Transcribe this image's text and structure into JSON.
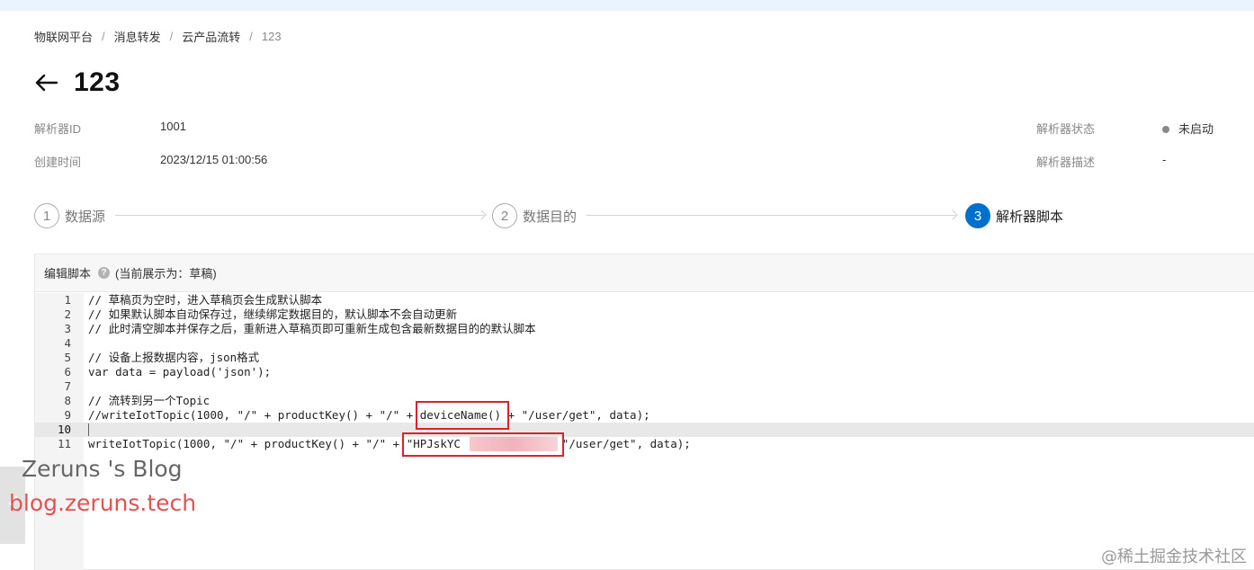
{
  "breadcrumb": {
    "items": [
      "物联网平台",
      "消息转发",
      "云产品流转"
    ],
    "current": "123",
    "separator": "/"
  },
  "page": {
    "title": "123"
  },
  "info": {
    "parser_id_label": "解析器ID",
    "parser_id_value": "1001",
    "created_label": "创建时间",
    "created_value": "2023/12/15 01:00:56",
    "status_label": "解析器状态",
    "status_value": "未启动",
    "desc_label": "解析器描述",
    "desc_value": "-"
  },
  "steps": [
    {
      "num": "1",
      "label": "数据源",
      "active": false
    },
    {
      "num": "2",
      "label": "数据目的",
      "active": false
    },
    {
      "num": "3",
      "label": "解析器脚本",
      "active": true
    }
  ],
  "editor": {
    "title": "编辑脚本",
    "help": "?",
    "draft_note": "(当前展示为：草稿)",
    "active_line": 10,
    "lines": [
      "// 草稿页为空时，进入草稿页会生成默认脚本",
      "// 如果默认脚本自动保存过，继续绑定数据目的，默认脚本不会自动更新",
      "// 此时清空脚本并保存之后，重新进入草稿页即可重新生成包含最新数据目的的默认脚本",
      "",
      "// 设备上报数据内容，json格式",
      "var data = payload('json');",
      "",
      "// 流转到另一个Topic",
      "//writeIotTopic(1000, \"/\" + productKey() + \"/\" + deviceName() + \"/user/get\", data);",
      "",
      "writeIotTopic(1000, \"/\" + productKey() + \"/\" + \"HPJskYC           \" + \"/user/get\", data);"
    ]
  },
  "watermarks": {
    "blog": "Zeruns 's Blog",
    "url": "blog.zeruns.tech",
    "corner": "@稀土掘金技术社区"
  },
  "colors": {
    "primary": "#0070cc",
    "highlight": "#d9232c",
    "topbar": "#eaf4fe"
  }
}
